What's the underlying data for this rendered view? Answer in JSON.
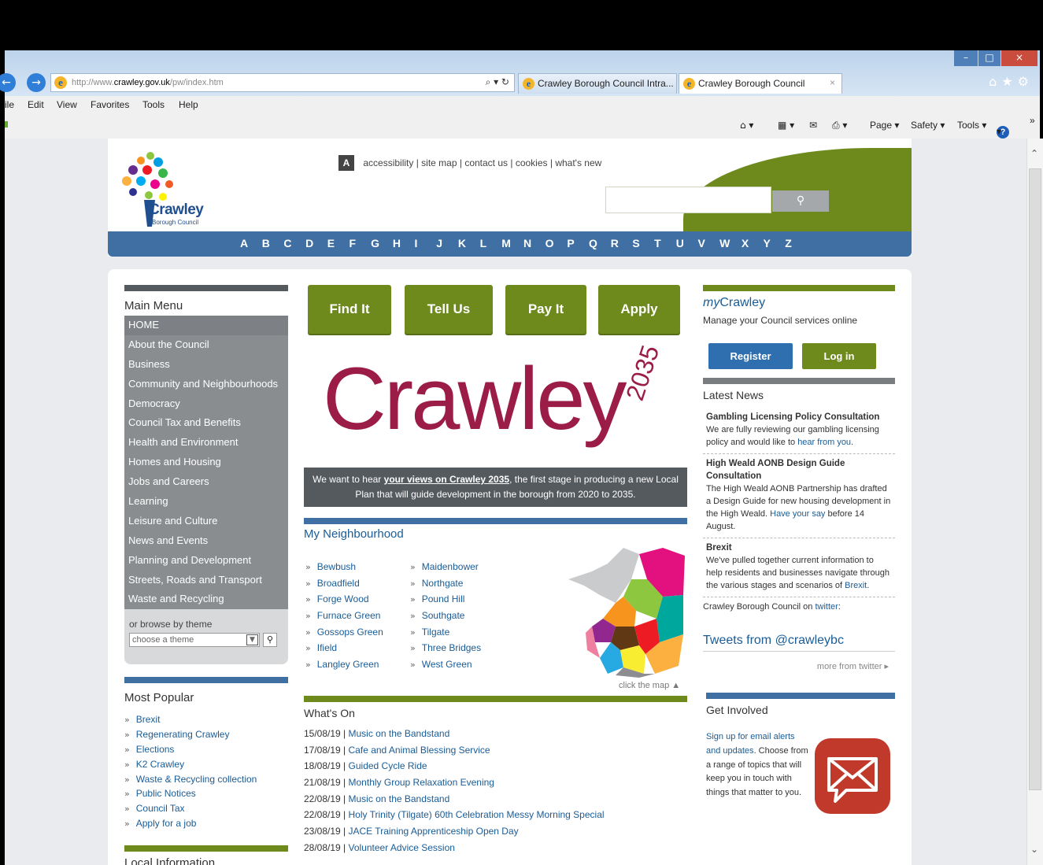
{
  "browser": {
    "url_prefix": "http://www.",
    "url_domain": "crawley.gov.uk",
    "url_path": "/pw/index.htm",
    "address_controls": "⌕ ▾ ↻",
    "tabs": [
      {
        "label": "Crawley Borough Council Intra..."
      },
      {
        "label": "Crawley Borough Council"
      }
    ],
    "tab_close": "×",
    "menu": [
      "ile",
      "Edit",
      "View",
      "Favorites",
      "Tools",
      "Help"
    ],
    "commands": {
      "page": "Page ▾",
      "safety": "Safety ▾",
      "tools": "Tools ▾",
      "help": "▾",
      "more": "»"
    },
    "window_controls": {
      "minimize": "–",
      "maximize": "□",
      "close": "×"
    }
  },
  "header": {
    "logo_text": "Crawley",
    "logo_sub": "Borough Council",
    "a_box": "A",
    "top_links": [
      "accessibility",
      "site map",
      "contact us",
      "cookies",
      "what's new"
    ],
    "search_placeholder": "",
    "az": [
      "A",
      "B",
      "C",
      "D",
      "E",
      "F",
      "G",
      "H",
      "I",
      "J",
      "K",
      "L",
      "M",
      "N",
      "O",
      "P",
      "Q",
      "R",
      "S",
      "T",
      "U",
      "V",
      "W",
      "X",
      "Y",
      "Z"
    ]
  },
  "left": {
    "main_menu_title": "Main Menu",
    "main_menu": [
      "HOME",
      "About the Council",
      "Business",
      "Community and Neighbourhoods",
      "Democracy",
      "Council Tax and Benefits",
      "Health and Environment",
      "Homes and Housing",
      "Jobs and Careers",
      "Learning",
      "Leisure and Culture",
      "News and Events",
      "Planning and Development",
      "Streets, Roads and Transport",
      "Waste and Recycling"
    ],
    "browse_label": "or browse by theme",
    "browse_select": "choose a theme",
    "most_popular_title": "Most Popular",
    "most_popular": [
      "Brexit",
      "Regenerating Crawley",
      "Elections",
      "K2 Crawley",
      "Waste & Recycling collection",
      "Public Notices",
      "Council Tax",
      "Apply for a job"
    ],
    "local_info_title": "Local Information"
  },
  "center": {
    "buttons": [
      "Find It",
      "Tell Us",
      "Pay It",
      "Apply"
    ],
    "promo_word": "Crawley",
    "promo_year": "2035",
    "banner_pre": "We want to hear ",
    "banner_link": "your views on Crawley 2035",
    "banner_post": ", the first stage in producing a new Local Plan that will guide development in the borough from 2020 to 2035.",
    "neighbourhood_title": "My Neighbourhood",
    "neighbourhoods_col1": [
      "Bewbush",
      "Broadfield",
      "Forge Wood",
      "Furnace Green",
      "Gossops Green",
      "Ifield",
      "Langley Green"
    ],
    "neighbourhoods_col2": [
      "Maidenbower",
      "Northgate",
      "Pound Hill",
      "Southgate",
      "Tilgate",
      "Three Bridges",
      "West Green"
    ],
    "click_map": "click the map ▲",
    "whats_on_title": "What's On",
    "events": [
      {
        "date": "15/08/19",
        "title": "Music on the Bandstand"
      },
      {
        "date": "17/08/19",
        "title": "Cafe and Animal Blessing Service"
      },
      {
        "date": "18/08/19",
        "title": "Guided Cycle Ride"
      },
      {
        "date": "21/08/19",
        "title": "Monthly Group Relaxation Evening"
      },
      {
        "date": "22/08/19",
        "title": "Music on the Bandstand"
      },
      {
        "date": "22/08/19",
        "title": "Holy Trinity (Tilgate) 60th Celebration Messy Morning Special"
      },
      {
        "date": "23/08/19",
        "title": "JACE Training Apprenticeship Open Day"
      },
      {
        "date": "28/08/19",
        "title": "Volunteer Advice Session"
      }
    ]
  },
  "right": {
    "my": "my",
    "crawley": "Crawley",
    "manage": "Manage your Council services online",
    "register": "Register",
    "login": "Log in",
    "latest_news_title": "Latest News",
    "news": [
      {
        "title": "Gambling Licensing Policy Consultation",
        "body": "We are fully reviewing our gambling licensing policy and would like to ",
        "link": "hear from you",
        "tail": "."
      },
      {
        "title": "High Weald AONB Design Guide Consultation",
        "body": "The High Weald AONB Partnership has drafted a Design Guide for new housing development in the High Weald. ",
        "link": "Have your say",
        "tail": " before 14 August."
      },
      {
        "title": "Brexit",
        "body": "We've pulled together current information to help residents and businesses navigate through the various stages and scenarios of ",
        "link": "Brexit",
        "tail": "."
      }
    ],
    "twitter_pre": "Crawley Borough Council on ",
    "twitter_link": "twitter",
    "twitter_tail": ":",
    "tweets_title": "Tweets from @crawleybc",
    "more_twitter": "more from twitter ▸",
    "get_involved_title": "Get Involved",
    "get_involved_link": "Sign up for email alerts and updates",
    "get_involved_text": ". Choose from a range of topics that will keep you in touch with things that matter to you."
  }
}
